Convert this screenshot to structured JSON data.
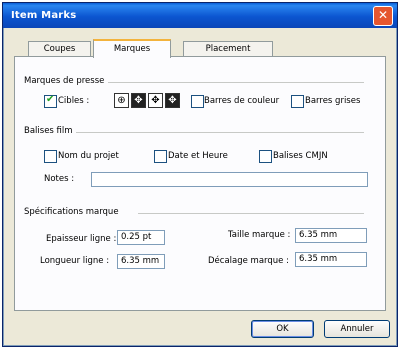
{
  "window": {
    "title": "Item Marks",
    "close_glyph": "✕"
  },
  "tabs": [
    {
      "label": "Coupes",
      "active": false
    },
    {
      "label": "Marques",
      "active": true
    },
    {
      "label": "Placement",
      "active": false
    }
  ],
  "print_marks": {
    "group_label": "Marques de presse",
    "targets_label": "Cibles :",
    "targets_checked": true,
    "mark_icons": [
      "crosshair-mark-icon",
      "target-mark-icon",
      "crosshair-mark-icon",
      "target-mark-icon"
    ],
    "color_bars_label": "Barres de couleur",
    "color_bars_checked": false,
    "gray_bars_label": "Barres grises",
    "gray_bars_checked": false
  },
  "film_tags": {
    "group_label": "Balises film",
    "project_name_label": "Nom du projet",
    "project_name_checked": false,
    "date_time_label": "Date et Heure",
    "date_time_checked": false,
    "cmyk_tags_label": "Balises CMJN",
    "cmyk_tags_checked": false,
    "notes_label": "Notes :",
    "notes_value": ""
  },
  "mark_specs": {
    "group_label": "Spécifications marque",
    "line_thickness_label": "Epaisseur ligne :",
    "line_thickness_value": "0.25 pt",
    "mark_size_label": "Taille marque :",
    "mark_size_value": "6.35 mm",
    "line_length_label": "Longueur ligne :",
    "line_length_value": "6.35 mm",
    "mark_offset_label": "Décalage marque :",
    "mark_offset_value": "6.35 mm"
  },
  "buttons": {
    "ok": "OK",
    "cancel": "Annuler"
  }
}
